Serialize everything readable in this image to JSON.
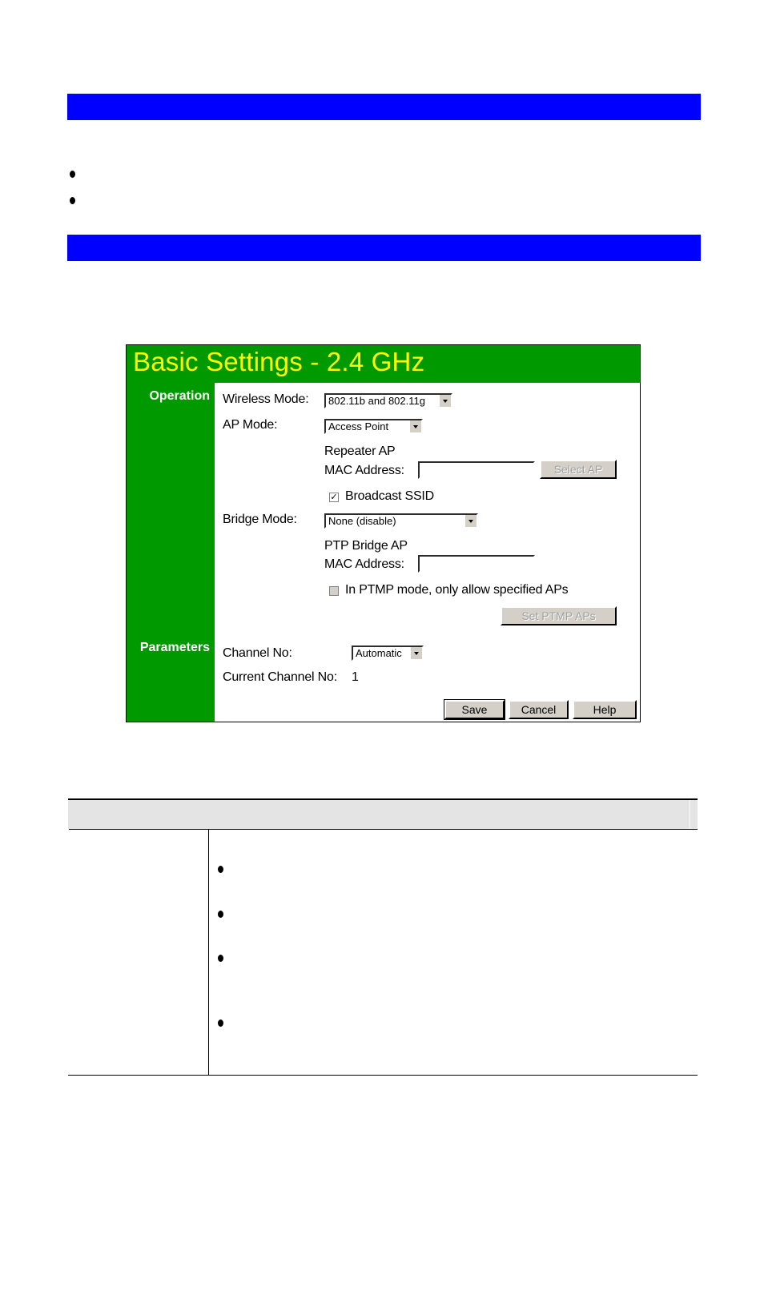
{
  "document": {
    "section_bars": [
      {
        "title": ""
      },
      {
        "title": ""
      }
    ],
    "intro_bullets": [
      "",
      ""
    ],
    "colors": {
      "section_bar": "#0000ff",
      "panel_green": "#009900",
      "panel_title": "#ffff00",
      "table_header": "#e4e4e4"
    }
  },
  "panel": {
    "title": "Basic Settings - 2.4 GHz",
    "sections": {
      "operation": "Operation",
      "parameters": "Parameters"
    },
    "wireless_mode": {
      "label": "Wireless Mode:",
      "value": "802.11b and 802.11g"
    },
    "ap_mode": {
      "label": "AP Mode:",
      "value": "Access Point"
    },
    "repeater": {
      "label_line1": "Repeater AP",
      "label_line2": "MAC Address:",
      "value": "",
      "select_button": "Select AP"
    },
    "broadcast_ssid": {
      "label": "Broadcast SSID",
      "checked": true,
      "check_glyph": "✓"
    },
    "bridge_mode": {
      "label": "Bridge Mode:",
      "value": "None (disable)"
    },
    "ptp_bridge": {
      "label_line1": "PTP Bridge AP",
      "label_line2": "MAC Address:",
      "value": ""
    },
    "ptmp_only": {
      "label": "In PTMP mode, only allow specified APs",
      "checked": false
    },
    "set_ptmp_button": "Set PTMP APs",
    "channel": {
      "label": "Channel No:",
      "value": "Automatic"
    },
    "current_channel": {
      "label": "Current Channel No:",
      "value": "1"
    },
    "buttons": {
      "save": "Save",
      "cancel": "Cancel",
      "help": "Help"
    }
  },
  "table": {
    "header": "",
    "rows": [
      {
        "name": "",
        "bullets": [
          "",
          "",
          "",
          ""
        ]
      }
    ]
  }
}
